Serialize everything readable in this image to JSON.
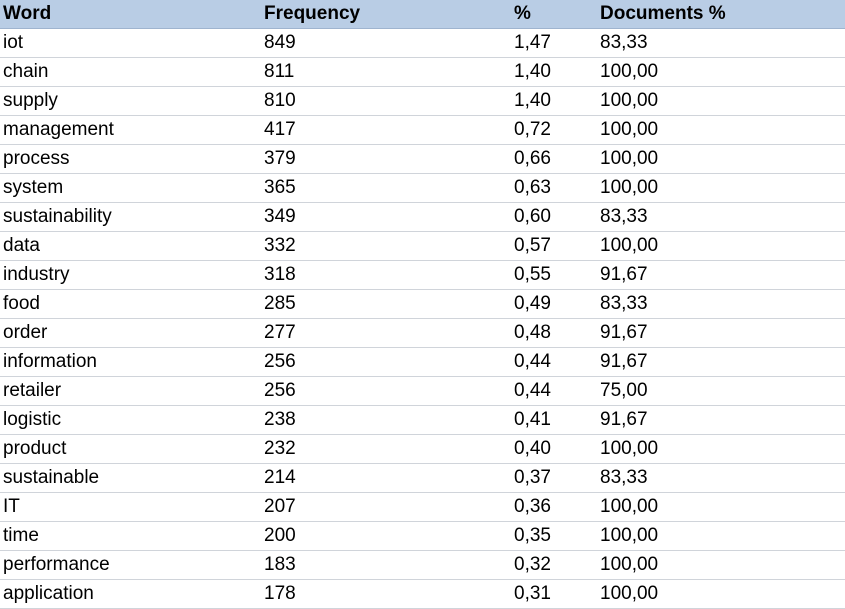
{
  "table": {
    "headers": {
      "word": "Word",
      "frequency": "Frequency",
      "percent": "%",
      "documents_percent": "Documents %"
    },
    "rows": [
      {
        "word": "iot",
        "frequency": "849",
        "percent": "1,47",
        "documents_percent": "83,33"
      },
      {
        "word": "chain",
        "frequency": "811",
        "percent": "1,40",
        "documents_percent": "100,00"
      },
      {
        "word": "supply",
        "frequency": "810",
        "percent": "1,40",
        "documents_percent": "100,00"
      },
      {
        "word": "management",
        "frequency": "417",
        "percent": "0,72",
        "documents_percent": "100,00"
      },
      {
        "word": "process",
        "frequency": "379",
        "percent": "0,66",
        "documents_percent": "100,00"
      },
      {
        "word": "system",
        "frequency": "365",
        "percent": "0,63",
        "documents_percent": "100,00"
      },
      {
        "word": "sustainability",
        "frequency": "349",
        "percent": "0,60",
        "documents_percent": "83,33"
      },
      {
        "word": "data",
        "frequency": "332",
        "percent": "0,57",
        "documents_percent": "100,00"
      },
      {
        "word": "industry",
        "frequency": "318",
        "percent": "0,55",
        "documents_percent": "91,67"
      },
      {
        "word": "food",
        "frequency": "285",
        "percent": "0,49",
        "documents_percent": "83,33"
      },
      {
        "word": "order",
        "frequency": "277",
        "percent": "0,48",
        "documents_percent": "91,67"
      },
      {
        "word": "information",
        "frequency": "256",
        "percent": "0,44",
        "documents_percent": "91,67"
      },
      {
        "word": "retailer",
        "frequency": "256",
        "percent": "0,44",
        "documents_percent": "75,00"
      },
      {
        "word": "logistic",
        "frequency": "238",
        "percent": "0,41",
        "documents_percent": "91,67"
      },
      {
        "word": "product",
        "frequency": "232",
        "percent": "0,40",
        "documents_percent": "100,00"
      },
      {
        "word": "sustainable",
        "frequency": "214",
        "percent": "0,37",
        "documents_percent": "83,33"
      },
      {
        "word": "IT",
        "frequency": "207",
        "percent": "0,36",
        "documents_percent": "100,00"
      },
      {
        "word": "time",
        "frequency": "200",
        "percent": "0,35",
        "documents_percent": "100,00"
      },
      {
        "word": "performance",
        "frequency": "183",
        "percent": "0,32",
        "documents_percent": "100,00"
      },
      {
        "word": "application",
        "frequency": "178",
        "percent": "0,31",
        "documents_percent": "100,00"
      }
    ]
  },
  "colors": {
    "header_background": "#b9cde5",
    "row_divider": "#d0d4da"
  }
}
